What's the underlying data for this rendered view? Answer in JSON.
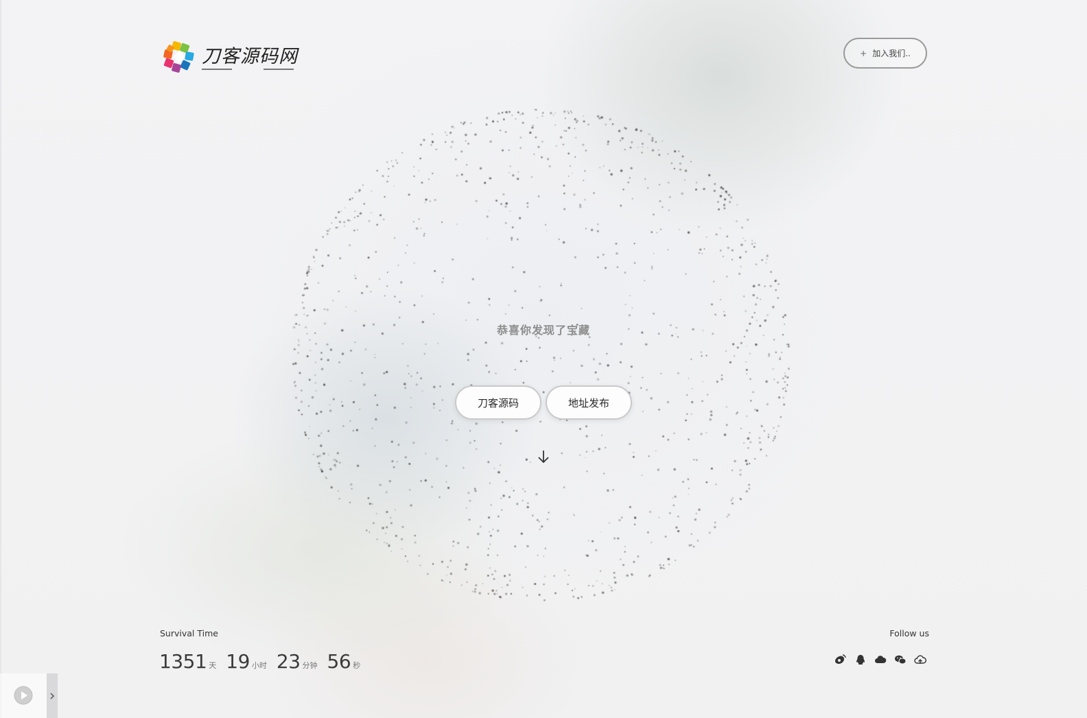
{
  "header": {
    "site_name": "刀客源码网",
    "join_label": "加入我们..",
    "join_icon": "plus-icon"
  },
  "hero": {
    "title": "恭喜你发现了宝藏",
    "buttons": [
      {
        "label": "刀客源码"
      },
      {
        "label": "地址发布"
      }
    ],
    "scroll_icon": "arrow-down-icon"
  },
  "survival": {
    "label": "Survival Time",
    "days": "1351",
    "days_unit": "天",
    "hours": "19",
    "hours_unit": "小时",
    "minutes": "23",
    "minutes_unit": "分钟",
    "seconds": "56",
    "seconds_unit": "秒"
  },
  "follow": {
    "label": "Follow us",
    "icons": [
      "weibo-icon",
      "qq-icon",
      "cloud-icon",
      "wechat-icon",
      "cloud-upload-icon"
    ]
  },
  "player": {
    "play_icon": "play-icon",
    "toggle_icon": "chevron-right-icon"
  },
  "colors": {
    "background": "#f2f2f4",
    "text": "#333333",
    "muted": "#8d8d8d"
  }
}
